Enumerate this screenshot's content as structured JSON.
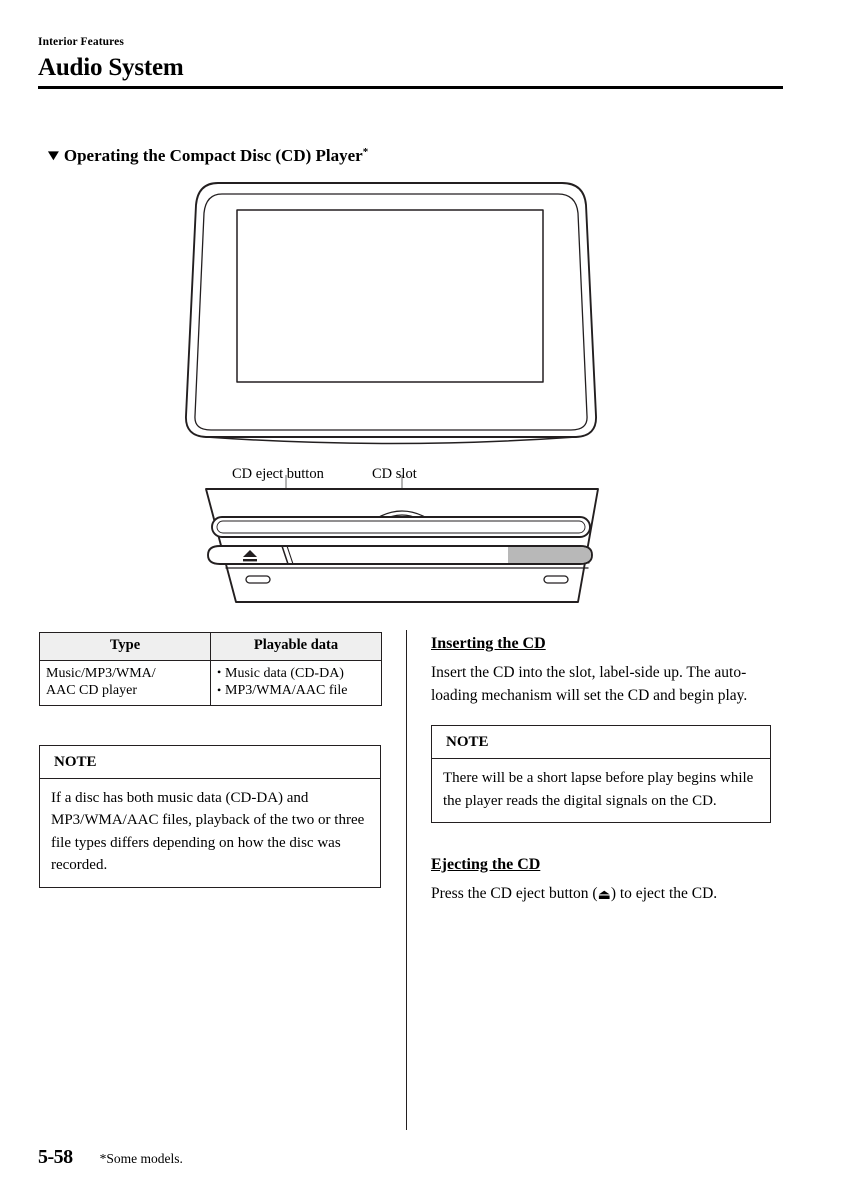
{
  "header": {
    "chapter_label": "Interior Features",
    "title": "Audio System"
  },
  "section": {
    "bullet_glyph": "▼",
    "heading": "Operating the Compact Disc (CD) Player",
    "footnote_marker": "*"
  },
  "illustration": {
    "labels": {
      "eject_button": "CD eject button",
      "cd_slot": "CD slot"
    },
    "eject_icon_glyph": "⏏",
    "colors": {
      "outline": "#231f20",
      "slot_shade": "#b8b8b8",
      "fill": "#ffffff"
    }
  },
  "spec_table": {
    "headers": [
      "Type",
      "Playable data"
    ],
    "rows": [
      {
        "type": "Music/MP3/WMA/\nAAC CD player",
        "playable_data": [
          "Music data (CD-DA)",
          "MP3/WMA/AAC file"
        ]
      }
    ],
    "header_bg": "#efefef"
  },
  "note_left": {
    "heading": "NOTE",
    "body": "If a disc has both music data (CD-DA) and MP3/WMA/AAC files, playback of the two or three file types differs depending on how the disc was recorded."
  },
  "inserting": {
    "heading": "Inserting the CD",
    "body": "Insert the CD into the slot, label-side up. The auto-loading mechanism will set the CD and begin play."
  },
  "note_right": {
    "heading": "NOTE",
    "body": "There will be a short lapse before play begins while the player reads the digital signals on the CD."
  },
  "ejecting": {
    "heading": "Ejecting the CD",
    "body_before": "Press the CD eject button (",
    "glyph": "⏏",
    "body_after": ") to eject the CD."
  },
  "footer": {
    "page_number": "5-58",
    "footnote": "*Some models."
  }
}
